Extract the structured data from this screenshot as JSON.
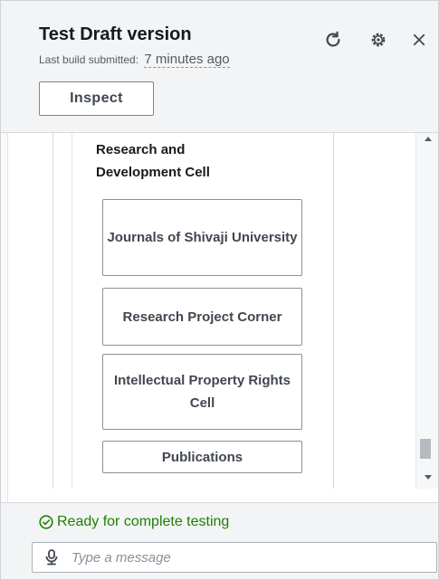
{
  "header": {
    "title": "Test Draft version",
    "last_build_label": "Last build submitted:",
    "last_build_time": "7 minutes ago",
    "inspect_label": "Inspect",
    "icons": [
      "refresh-icon",
      "settings-icon",
      "close-icon"
    ]
  },
  "content": {
    "section_heading": "Research and Development Cell",
    "buttons": [
      {
        "label": "Journals of Shivaji University"
      },
      {
        "label": "Research Project Corner"
      },
      {
        "label": "Intellectual Property Rights Cell"
      },
      {
        "label": "Publications"
      }
    ]
  },
  "footer": {
    "status": "Ready for complete testing",
    "message_placeholder": "Type a message"
  },
  "colors": {
    "status_green": "#1d8102",
    "header_bg": "#f3f4f5",
    "text_dark": "#16191f"
  }
}
